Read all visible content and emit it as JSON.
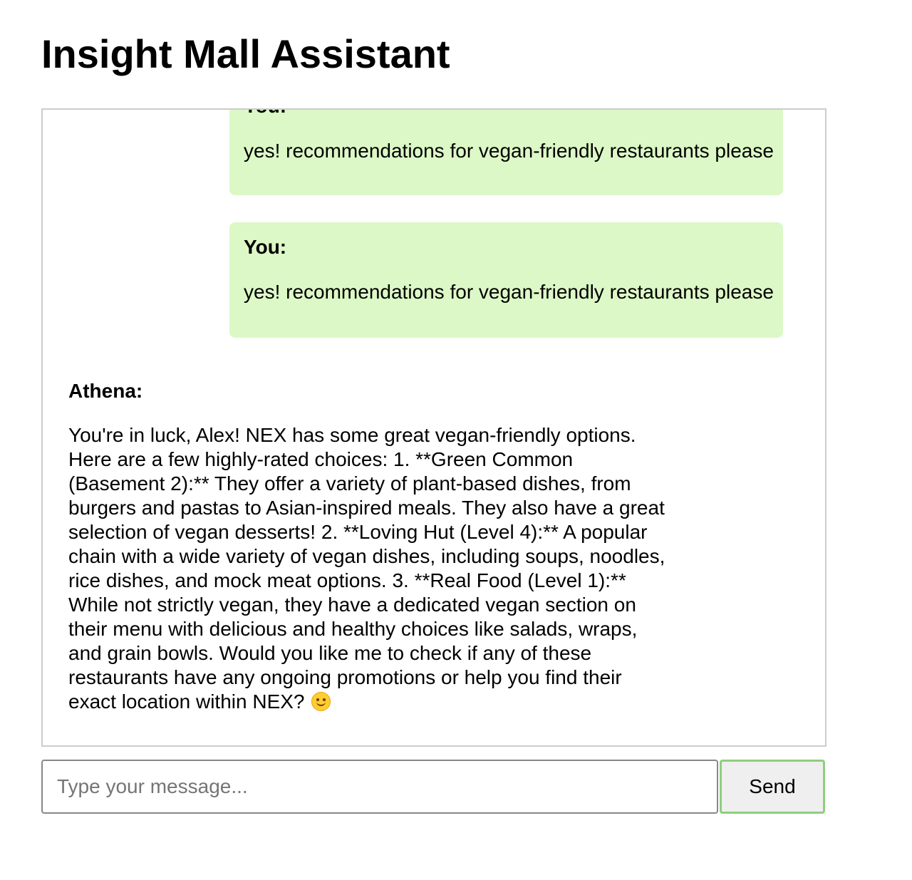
{
  "header": {
    "title": "Insight Mall Assistant"
  },
  "chat": {
    "messages": [
      {
        "sender": "You:",
        "text": "yes! recommendations for vegan-friendly restaurants please"
      },
      {
        "sender": "You:",
        "text": "yes! recommendations for vegan-friendly restaurants please"
      },
      {
        "sender": "Athena:",
        "text": "You're in luck, Alex! NEX has some great vegan-friendly options. Here are a few highly-rated choices: 1. **Green Common (Basement 2):** They offer a variety of plant-based dishes, from burgers and pastas to Asian-inspired meals. They also have a great selection of vegan desserts! 2. **Loving Hut (Level 4):** A popular chain with a wide variety of vegan dishes, including soups, noodles, rice dishes, and mock meat options. 3. **Real Food (Level 1):** While not strictly vegan, they have a dedicated vegan section on their menu with delicious and healthy choices like salads, wraps, and grain bowls. Would you like me to check if any of these restaurants have any ongoing promotions or help you find their exact location within NEX?",
        "emoji": "smiling-face-icon"
      }
    ]
  },
  "composer": {
    "placeholder": "Type your message...",
    "value": "",
    "send_label": "Send"
  },
  "colors": {
    "user_bubble": "#dcf8c6",
    "send_border": "#8fce7f",
    "chat_border": "#cccccc"
  }
}
